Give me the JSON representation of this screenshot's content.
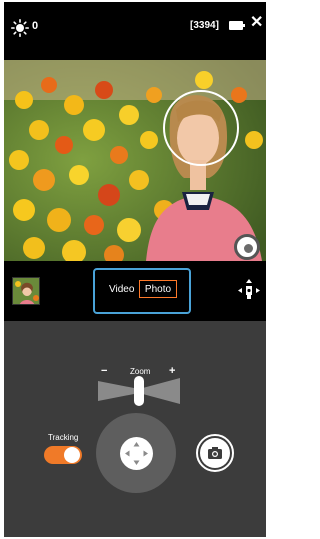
{
  "status": {
    "ev_value": "0",
    "remaining_shots": "[3394]",
    "close_symbol": "✕"
  },
  "mode": {
    "video_label": "Video",
    "photo_label": "Photo",
    "selected": "Photo"
  },
  "controls": {
    "zoom_label": "Zoom",
    "zoom_minus": "−",
    "zoom_plus": "+",
    "tracking_label": "Tracking",
    "tracking_on": true
  },
  "colors": {
    "accent": "#f07a28",
    "mode_highlight": "#4aa3d8",
    "panel_bg": "#3c3c3c"
  },
  "icons": {
    "brightness": "sun-icon",
    "battery": "battery-icon",
    "close": "close-icon",
    "orientation": "camera-orientation-icon",
    "shutter": "camera-icon",
    "joystick": "direction-pad-icon"
  }
}
